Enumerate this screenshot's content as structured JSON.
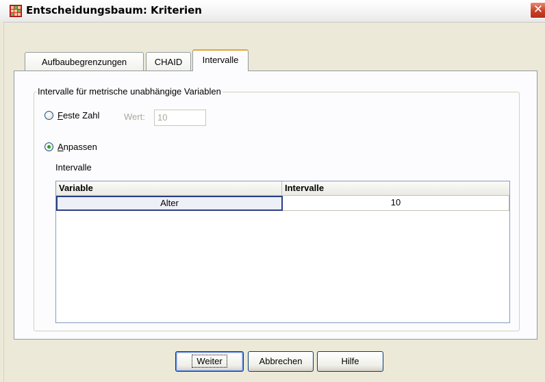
{
  "window": {
    "title": "Entscheidungsbaum: Kriterien",
    "close_glyph": "✕",
    "icon": "spss-grid-icon"
  },
  "tabs": [
    {
      "label": "Aufbaubegrenzungen",
      "active": false
    },
    {
      "label": "CHAID",
      "active": false
    },
    {
      "label": "Intervalle",
      "active": true
    }
  ],
  "group": {
    "legend": "Intervalle für metrische unabhängige Variablen",
    "options": [
      {
        "label": "Feste Zahl",
        "mnemonic": "F",
        "rest": "este Zahl",
        "checked": false
      },
      {
        "label": "Anpassen",
        "mnemonic": "A",
        "rest": "npassen",
        "checked": true
      }
    ],
    "wert": {
      "label": "Wert:",
      "value": "10",
      "enabled": false
    },
    "intervals_label": "Intervalle",
    "table": {
      "columns": [
        "Variable",
        "Intervalle"
      ],
      "rows": [
        {
          "variable": "Alter",
          "intervalle": "10"
        }
      ]
    }
  },
  "buttons": {
    "weiter": "Weiter",
    "abbrechen": "Abbrechen",
    "hilfe": "Hilfe"
  },
  "colors": {
    "dialog_bg": "#ece9d8",
    "panel_bg": "#fcfcfe",
    "active_tab_accent": "#e6a431",
    "radio_dot": "#21a121",
    "selected_cell_border": "#2a3e84",
    "close_button": "#c8402a"
  }
}
